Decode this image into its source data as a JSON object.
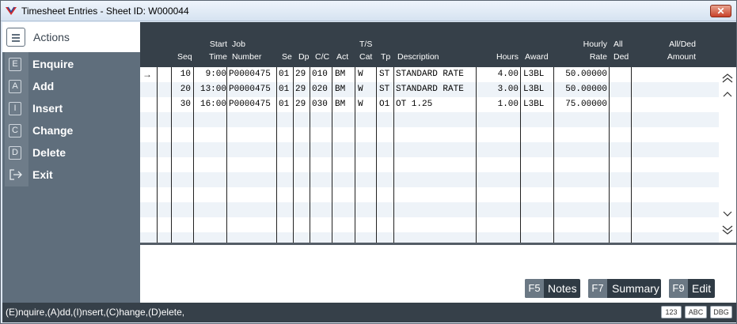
{
  "window": {
    "title": "Timesheet Entries - Sheet ID: W000044",
    "close_label": "✕"
  },
  "sidebar": {
    "header_label": "Actions",
    "items": [
      {
        "key": "E",
        "label": "Enquire"
      },
      {
        "key": "A",
        "label": "Add"
      },
      {
        "key": "I",
        "label": "Insert"
      },
      {
        "key": "C",
        "label": "Change"
      },
      {
        "key": "D",
        "label": "Delete"
      },
      {
        "key": "→",
        "label": "Exit"
      }
    ]
  },
  "columns": {
    "seq": "Seq",
    "start_l1": "Start",
    "start_l2": "Time",
    "job_l1": "Job",
    "job_l2": "Number",
    "se": "Se",
    "dp": "Dp",
    "cc": "C/C",
    "act": "Act",
    "ts_l1": "T/S",
    "ts_l2": "Cat",
    "tp": "Tp",
    "desc": "Description",
    "hours": "Hours",
    "award": "Award",
    "rate_l1": "Hourly",
    "rate_l2": "Rate",
    "allded_l1": "All",
    "allded_l2": "Ded",
    "amount_l1": "All/Ded",
    "amount_l2": "Amount"
  },
  "rows": [
    {
      "seq": "10",
      "start": "9:00",
      "job": "P0000475",
      "se": "01",
      "dp": "29",
      "cc": "010",
      "act": "BM",
      "ts": "W",
      "tp": "ST",
      "desc": "STANDARD RATE",
      "hours": "4.00",
      "award": "L3BL",
      "rate": "50.00000"
    },
    {
      "seq": "20",
      "start": "13:00",
      "job": "P0000475",
      "se": "01",
      "dp": "29",
      "cc": "020",
      "act": "BM",
      "ts": "W",
      "tp": "ST",
      "desc": "STANDARD RATE",
      "hours": "3.00",
      "award": "L3BL",
      "rate": "50.00000"
    },
    {
      "seq": "30",
      "start": "16:00",
      "job": "P0000475",
      "se": "01",
      "dp": "29",
      "cc": "030",
      "act": "BM",
      "ts": "W",
      "tp": "O1",
      "desc": "OT 1.25",
      "hours": "1.00",
      "award": "L3BL",
      "rate": "75.00000"
    }
  ],
  "current_row_marker": "→",
  "function_keys": [
    {
      "key": "F5",
      "label": "Notes"
    },
    {
      "key": "F7",
      "label": "Summary"
    },
    {
      "key": "F9",
      "label": "Edit"
    }
  ],
  "status": {
    "text": "(E)nquire,(A)dd,(I)nsert,(C)hange,(D)elete,",
    "badges": [
      "123",
      "ABC",
      "DBG"
    ]
  }
}
